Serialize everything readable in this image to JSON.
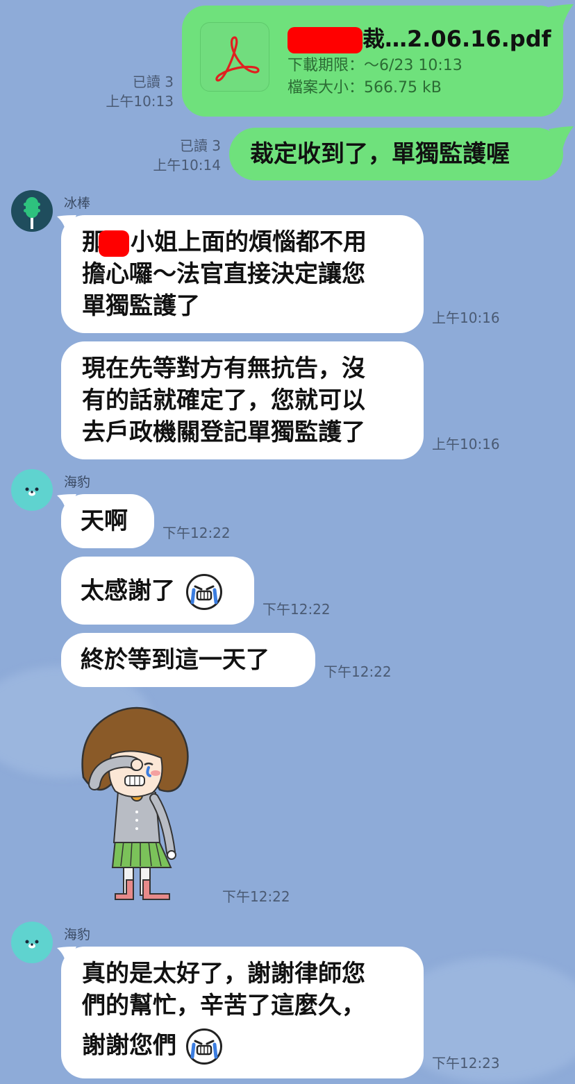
{
  "messages": {
    "file": {
      "name_suffix": "裁…2.06.16.pdf",
      "expiry_label": "下載期限：～6/23 10:13",
      "size_label": "檔案大小：566.75 kB",
      "read": "已讀 3",
      "time": "上午10:13",
      "icon": "pdf-icon"
    },
    "out1": {
      "text": "裁定收到了，單獨監護喔",
      "read": "已讀 3",
      "time": "上午10:14"
    },
    "sender1": {
      "name": "冰棒"
    },
    "in1": {
      "pre": "那",
      "post": "小姐上面的煩惱都不用",
      "line2": "擔心囉～法官直接決定讓您",
      "line3": "單獨監護了",
      "time": "上午10:16"
    },
    "in2": {
      "line1": "現在先等對方有無抗告，沒",
      "line2": "有的話就確定了，您就可以",
      "line3": "去戶政機關登記單獨監護了",
      "time": "上午10:16"
    },
    "sender2": {
      "name": "海豹"
    },
    "in3": {
      "text": "天啊",
      "time": "下午12:22"
    },
    "in4": {
      "text": "太感謝了",
      "time": "下午12:22"
    },
    "in5": {
      "text": "終於等到這一天了",
      "time": "下午12:22"
    },
    "sticker": {
      "time": "下午12:22"
    },
    "sender3": {
      "name": "海豹"
    },
    "in6": {
      "line1": "真的是太好了，謝謝律師您",
      "line2": "們的幫忙，辛苦了這麼久，",
      "line3": "謝謝您們",
      "time": "下午12:23"
    }
  },
  "colors": {
    "background": "#8eabd8",
    "outgoing": "#6fe17c",
    "incoming": "#ffffff",
    "redaction": "#ff0000"
  }
}
